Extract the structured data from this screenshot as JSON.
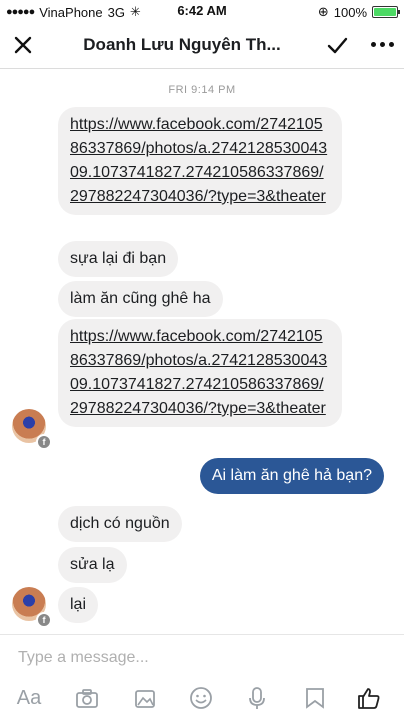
{
  "status_bar": {
    "carrier": "VinaPhone",
    "network": "3G",
    "time": "6:42 AM",
    "battery": "100%"
  },
  "header": {
    "title": "Doanh Lưu Nguyên Th..."
  },
  "timestamp": "FRI 9:14 PM",
  "messages": [
    {
      "from": "them",
      "text": "https://www.facebook.com/274210586337869/photos/a.274212853004309.1073741827.274210586337869/297882247304036/?type=3&theater"
    },
    {
      "from": "them",
      "text": "sựa lại đi bạn"
    },
    {
      "from": "them",
      "text": "làm ăn cũng ghê ha"
    },
    {
      "from": "them",
      "text": "https://www.facebook.com/274210586337869/photos/a.274212853004309.1073741827.274210586337869/297882247304036/?type=3&theater"
    },
    {
      "from": "me",
      "text": "Ai làm ăn ghê hả bạn?"
    },
    {
      "from": "them",
      "text": "dịch có nguồn"
    },
    {
      "from": "them",
      "text": "sửa lạ"
    },
    {
      "from": "them",
      "text": "lại"
    }
  ],
  "composer": {
    "placeholder": "Type a message...",
    "aa_label": "Aa"
  },
  "colors": {
    "me_bubble": "#2b5796",
    "them_bubble": "#f1f0f0"
  }
}
